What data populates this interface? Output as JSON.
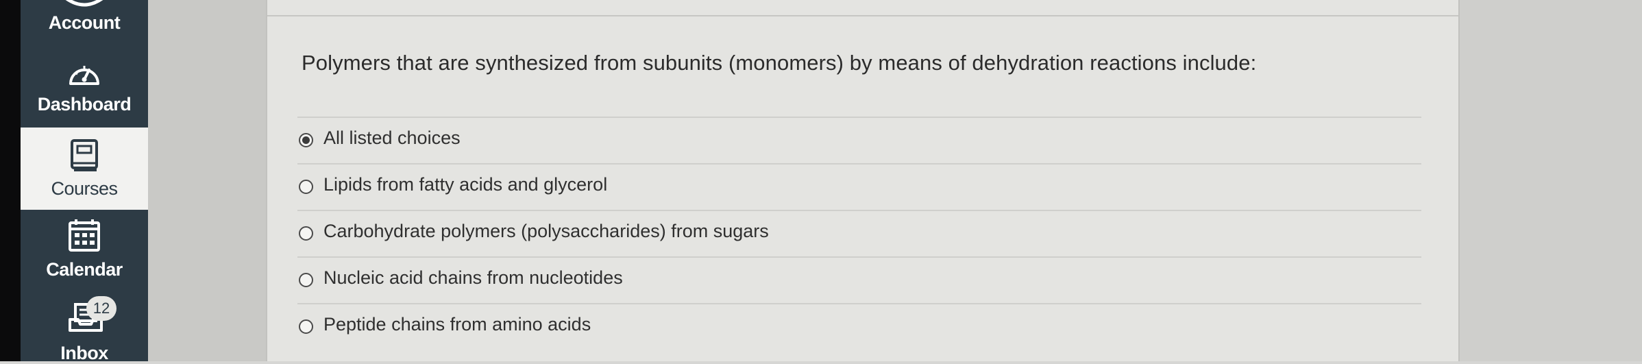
{
  "nav": {
    "items": [
      {
        "label": "Account",
        "icon": "account-icon"
      },
      {
        "label": "Dashboard",
        "icon": "dashboard-icon"
      },
      {
        "label": "Courses",
        "icon": "courses-icon",
        "active": true
      },
      {
        "label": "Calendar",
        "icon": "calendar-icon"
      },
      {
        "label": "Inbox",
        "icon": "inbox-icon",
        "badge": "12"
      }
    ]
  },
  "quiz": {
    "question": "Polymers that are synthesized from subunits (monomers) by means of dehydration reactions include:",
    "answers": [
      {
        "text": "All listed choices",
        "selected": true
      },
      {
        "text": "Lipids from fatty acids and glycerol",
        "selected": false
      },
      {
        "text": "Carbohydrate polymers (polysaccharides) from sugars",
        "selected": false
      },
      {
        "text": "Nucleic acid chains from nucleotides",
        "selected": false
      },
      {
        "text": "Peptide chains from amino acids",
        "selected": false
      }
    ]
  },
  "colors": {
    "nav_bg": "#2d3b45",
    "active_bg": "#f2f2f0"
  }
}
